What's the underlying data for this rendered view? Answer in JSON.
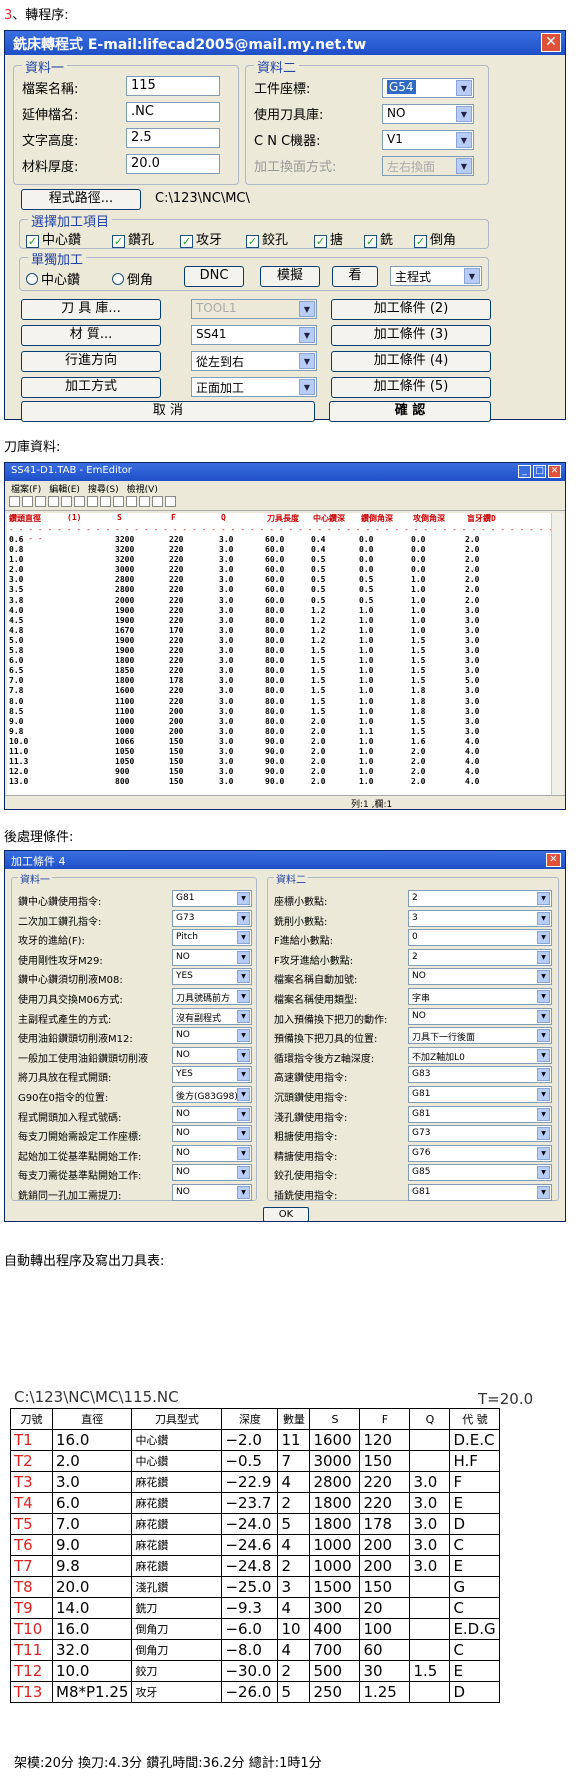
{
  "headings": {
    "h1_num": "3",
    "h1_text": "、轉程序:",
    "h2": "刀庫資料:",
    "h3": "後處理條件:",
    "h4": "自動轉出程序及寫出刀具表:"
  },
  "w1": {
    "title": "銑床轉程式  E-mail:lifecad2005@mail.my.net.tw",
    "close": "✕",
    "g1": "資料一",
    "g2": "資料二",
    "f_name_l": "檔案名稱:",
    "f_name": "115",
    "f_ext_l": "延伸檔名:",
    "f_ext": ".NC",
    "f_txt_l": "文字高度:",
    "f_txt": "2.5",
    "f_thk_l": "材料厚度:",
    "f_thk": "20.0",
    "r_coord_l": "工件座標:",
    "r_coord": "G54",
    "r_lib_l": "使用刀具庫:",
    "r_lib": "NO",
    "r_cnc_l": "C N C機器:",
    "r_cnc": "V1",
    "r_face_l": "加工換面方式:",
    "r_face": "左右換面",
    "path_btn": "程式路徑...",
    "path": "C:\\123\\NC\\MC\\",
    "g3": "選擇加工項目",
    "checks": [
      "中心鑽",
      "鑽孔",
      "攻牙",
      "鉸孔",
      "搪",
      "銑",
      "倒角"
    ],
    "g4": "單獨加工",
    "rad1": "中心鑽",
    "rad2": "倒角",
    "dnc": "DNC",
    "sim": "模擬",
    "look": "看",
    "main": "主程式",
    "b_lib": "刀 具 庫...",
    "s_tool": "TOOL1",
    "b_c2": "加工條件 (2)",
    "b_mat": "材    質...",
    "s_mat": "SS41",
    "b_c3": "加工條件 (3)",
    "b_dir": "行進方向",
    "s_dir": "從左到右",
    "b_c4": "加工條件 (4)",
    "b_meth": "加工方式",
    "s_meth": "正面加工",
    "b_c5": "加工條件 (5)",
    "cancel": "取    消",
    "ok": "確    認"
  },
  "w2": {
    "title": "SS41-D1.TAB - EmEditor",
    "menu": [
      "檔案(F)",
      "編輯(E)",
      "搜尋(S)",
      "檢視(V)"
    ],
    "header": [
      "鑽頭直徑",
      "(1)",
      "S",
      "F",
      "Q",
      "刀具長度",
      "中心鑽深",
      "鑽倒角深",
      "攻倒角深",
      "盲牙鑽D"
    ],
    "rows": [
      [
        "0.6",
        "3200",
        "220",
        "3.0",
        "60.0",
        "0.4",
        "0.0",
        "0.0",
        "2.0"
      ],
      [
        "0.8",
        "3200",
        "220",
        "3.0",
        "60.0",
        "0.4",
        "0.0",
        "0.0",
        "2.0"
      ],
      [
        "1.0",
        "3200",
        "220",
        "3.0",
        "60.0",
        "0.5",
        "0.0",
        "0.0",
        "2.0"
      ],
      [
        "2.0",
        "3000",
        "220",
        "3.0",
        "60.0",
        "0.5",
        "0.0",
        "0.0",
        "2.0"
      ],
      [
        "3.0",
        "2800",
        "220",
        "3.0",
        "60.0",
        "0.5",
        "0.5",
        "1.0",
        "2.0"
      ],
      [
        "3.5",
        "2800",
        "220",
        "3.0",
        "60.0",
        "0.5",
        "0.5",
        "1.0",
        "2.0"
      ],
      [
        "3.8",
        "2000",
        "220",
        "3.0",
        "60.0",
        "0.5",
        "0.5",
        "1.0",
        "2.0"
      ],
      [
        "4.0",
        "1900",
        "220",
        "3.0",
        "80.0",
        "1.2",
        "1.0",
        "1.0",
        "3.0"
      ],
      [
        "4.5",
        "1900",
        "220",
        "3.0",
        "80.0",
        "1.2",
        "1.0",
        "1.0",
        "3.0"
      ],
      [
        "4.8",
        "1670",
        "170",
        "3.0",
        "80.0",
        "1.2",
        "1.0",
        "1.0",
        "3.0"
      ],
      [
        "5.0",
        "1900",
        "220",
        "3.0",
        "80.0",
        "1.2",
        "1.0",
        "1.5",
        "3.0"
      ],
      [
        "5.8",
        "1900",
        "220",
        "3.0",
        "80.0",
        "1.5",
        "1.0",
        "1.5",
        "3.0"
      ],
      [
        "6.0",
        "1800",
        "220",
        "3.0",
        "80.0",
        "1.5",
        "1.0",
        "1.5",
        "3.0"
      ],
      [
        "6.5",
        "1850",
        "220",
        "3.0",
        "80.0",
        "1.5",
        "1.0",
        "1.5",
        "3.0"
      ],
      [
        "7.0",
        "1800",
        "178",
        "3.0",
        "80.0",
        "1.5",
        "1.0",
        "1.5",
        "5.0"
      ],
      [
        "7.8",
        "1600",
        "220",
        "3.0",
        "80.0",
        "1.5",
        "1.0",
        "1.8",
        "3.0"
      ],
      [
        "8.0",
        "1100",
        "220",
        "3.0",
        "80.0",
        "1.5",
        "1.0",
        "1.8",
        "3.0"
      ],
      [
        "8.5",
        "1100",
        "200",
        "3.0",
        "80.0",
        "1.5",
        "1.0",
        "1.8",
        "3.0"
      ],
      [
        "9.0",
        "1000",
        "200",
        "3.0",
        "80.0",
        "2.0",
        "1.0",
        "1.5",
        "3.0"
      ],
      [
        "9.8",
        "1000",
        "200",
        "3.0",
        "80.0",
        "2.0",
        "1.1",
        "1.5",
        "3.0"
      ],
      [
        "10.0",
        "1066",
        "150",
        "3.0",
        "90.0",
        "2.0",
        "1.0",
        "1.6",
        "4.0"
      ],
      [
        "11.0",
        "1050",
        "150",
        "3.0",
        "90.0",
        "2.0",
        "1.0",
        "2.0",
        "4.0"
      ],
      [
        "11.3",
        "1050",
        "150",
        "3.0",
        "90.0",
        "2.0",
        "1.0",
        "2.0",
        "4.0"
      ],
      [
        "12.0",
        "900",
        "150",
        "3.0",
        "90.0",
        "2.0",
        "1.0",
        "2.0",
        "4.0"
      ],
      [
        "13.0",
        "800",
        "150",
        "3.0",
        "90.0",
        "2.0",
        "1.0",
        "2.0",
        "4.0"
      ]
    ],
    "status": "列:1    ,欄:1"
  },
  "w3": {
    "title": "加工條件 4",
    "g1": "資料一",
    "g2": "資料二",
    "left": [
      [
        "鑽中心鑽使用指令:",
        "G81"
      ],
      [
        "二次加工鑽孔指令:",
        "G73"
      ],
      [
        "攻牙的進給(F):",
        "Pitch"
      ],
      [
        "使用剛性攻牙M29:",
        "NO"
      ],
      [
        "鑽中心鑽須切削液M08:",
        "YES"
      ],
      [
        "使用刀具交換M06方式:",
        "刀具號碼前方"
      ],
      [
        "主副程式產生的方式:",
        "沒有副程式"
      ],
      [
        "使用油鉛鑽頭切削液M12:",
        "NO"
      ],
      [
        "一般加工使用油鉛鑽頭切削液",
        "NO"
      ],
      [
        "將刀具放在程式開頭:",
        "YES"
      ],
      [
        "G90在0指令的位置:",
        "後方(G83G98)"
      ],
      [
        "程式開頭加入程式號碼:",
        "NO"
      ],
      [
        "每支刀開始需設定工作座標:",
        "NO"
      ],
      [
        "起始加工從基準點開始工作:",
        "NO"
      ],
      [
        "每支刀需從基準點開始工作:",
        "NO"
      ],
      [
        "銑銷同一孔加工需提刀:",
        "NO"
      ]
    ],
    "right": [
      [
        "座標小數點:",
        "2"
      ],
      [
        "銑削小數點:",
        "3"
      ],
      [
        "F進給小數點:",
        "0"
      ],
      [
        "F攻牙進給小數點:",
        "2"
      ],
      [
        "檔案名稱自動加號:",
        "NO"
      ],
      [
        "檔案名稱使用類型:",
        "字串"
      ],
      [
        "加入預備換下把刀的動作:",
        "NO"
      ],
      [
        "預備換下把刀具的位置:",
        "刀具下一行後面"
      ],
      [
        "循環指令後方Z軸深度:",
        "不加Z軸加L0"
      ],
      [
        "高速鑽使用指令:",
        "G83"
      ],
      [
        "沉頭鑽使用指令:",
        "G81"
      ],
      [
        "淺孔鑽使用指令:",
        "G81"
      ],
      [
        "粗搪使用指令:",
        "G73"
      ],
      [
        "精搪使用指令:",
        "G76"
      ],
      [
        "鉸孔使用指令:",
        "G85"
      ],
      [
        "插銑使用指令:",
        "G81"
      ]
    ],
    "ok": "OK"
  },
  "report": {
    "path": "C:\\123\\NC\\MC\\115.NC",
    "t": "T=20.0",
    "cols": [
      "刀號",
      "直徑",
      "刀具型式",
      "深度",
      "數量",
      "S",
      "F",
      "Q",
      "代  號"
    ],
    "rows": [
      [
        "T1",
        "16.0",
        "中心鑽",
        "−2.0",
        "11",
        "1600",
        "120",
        "",
        "D.E.C"
      ],
      [
        "T2",
        "2.0",
        "中心鑽",
        "−0.5",
        "7",
        "3000",
        "150",
        "",
        "H.F"
      ],
      [
        "T3",
        "3.0",
        "麻花鑽",
        "−22.9",
        "4",
        "2800",
        "220",
        "3.0",
        "F"
      ],
      [
        "T4",
        "6.0",
        "麻花鑽",
        "−23.7",
        "2",
        "1800",
        "220",
        "3.0",
        "E"
      ],
      [
        "T5",
        "7.0",
        "麻花鑽",
        "−24.0",
        "5",
        "1800",
        "178",
        "3.0",
        "D"
      ],
      [
        "T6",
        "9.0",
        "麻花鑽",
        "−24.6",
        "4",
        "1000",
        "200",
        "3.0",
        "C"
      ],
      [
        "T7",
        "9.8",
        "麻花鑽",
        "−24.8",
        "2",
        "1000",
        "200",
        "3.0",
        "E"
      ],
      [
        "T8",
        "20.0",
        "淺孔鑽",
        "−25.0",
        "3",
        "1500",
        "150",
        "",
        "G"
      ],
      [
        "T9",
        "14.0",
        "銑刀",
        "−9.3",
        "4",
        "300",
        "20",
        "",
        "C"
      ],
      [
        "T10",
        "16.0",
        "倒角刀",
        "−6.0",
        "10",
        "400",
        "100",
        "",
        "E.D.G"
      ],
      [
        "T11",
        "32.0",
        "倒角刀",
        "−8.0",
        "4",
        "700",
        "60",
        "",
        "C"
      ],
      [
        "T12",
        "10.0",
        "鉸刀",
        "−30.0",
        "2",
        "500",
        "30",
        "1.5",
        "E"
      ],
      [
        "T13",
        "M8*P1.25",
        "攻牙",
        "−26.0",
        "5",
        "250",
        "1.25",
        "",
        "D"
      ]
    ],
    "footer": "架模:20分  換刀:4.3分  鑽孔時間:36.2分  總計:1時1分"
  }
}
